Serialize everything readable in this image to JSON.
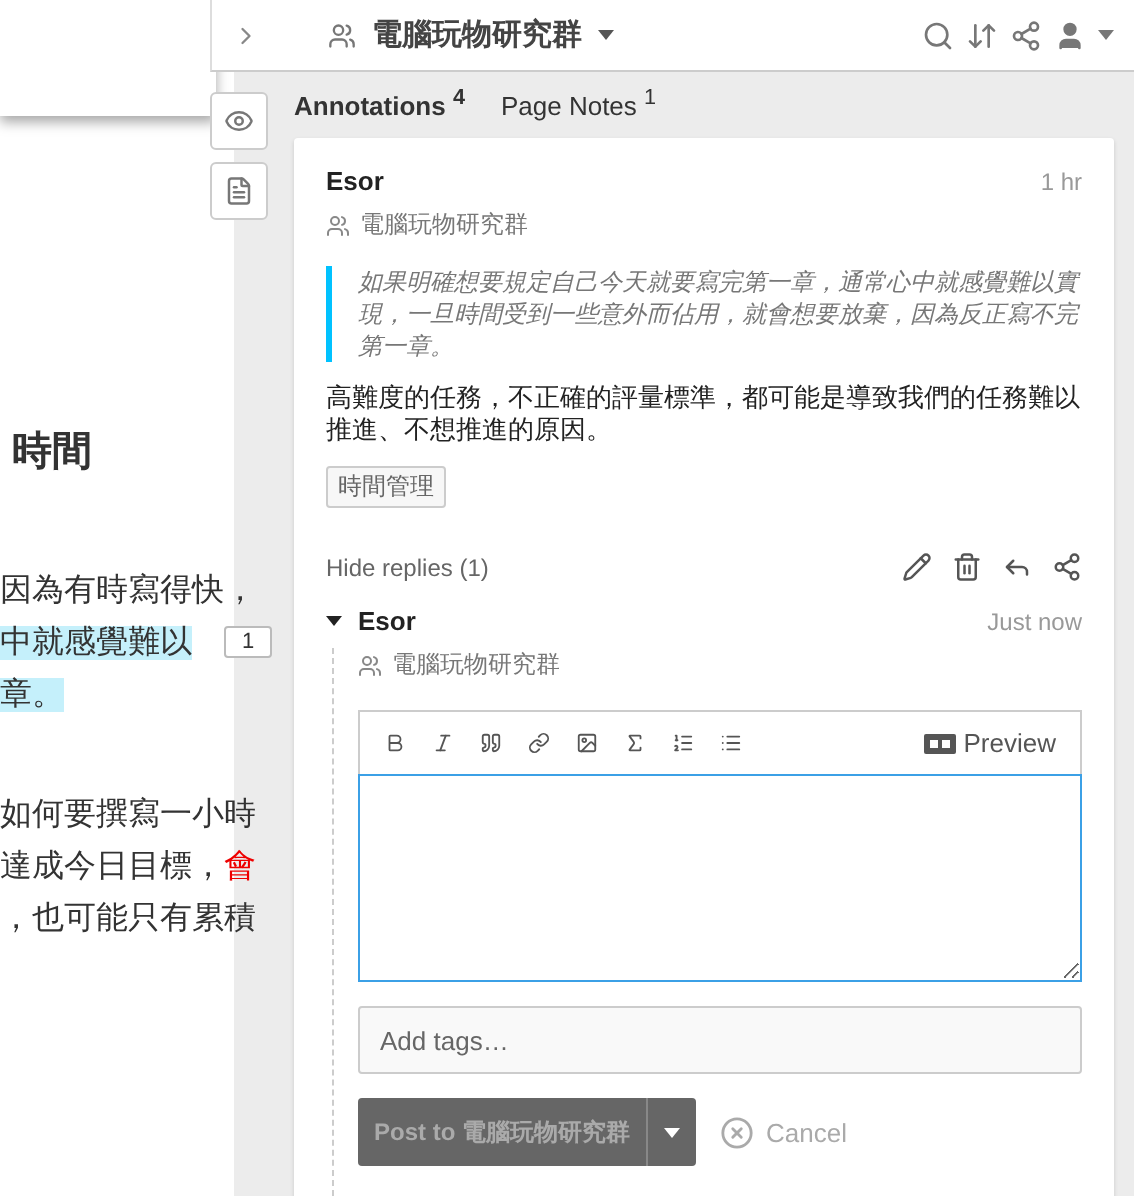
{
  "page": {
    "heading": "時間",
    "paragraphs": [
      {
        "lines": [
          {
            "segments": [
              {
                "text": "因為有時寫得快，",
                "highlighted": false,
                "emphasis": false
              }
            ]
          },
          {
            "segments": [
              {
                "text": "中就感覺難以",
                "highlighted": true,
                "emphasis": false
              }
            ],
            "badge": "1"
          },
          {
            "segments": [
              {
                "text": "章。",
                "highlighted": true,
                "emphasis": false
              }
            ]
          }
        ]
      },
      {
        "lines": [
          {
            "segments": [
              {
                "text": "如何要撰寫一小時",
                "highlighted": false,
                "emphasis": false
              }
            ]
          },
          {
            "segments": [
              {
                "text": "達成今日目標，",
                "highlighted": false,
                "emphasis": false
              },
              {
                "text": "會",
                "highlighted": false,
                "emphasis": true
              }
            ]
          },
          {
            "segments": [
              {
                "text": "，也可能只有累積",
                "highlighted": false,
                "emphasis": false
              }
            ]
          }
        ]
      }
    ]
  },
  "top_bar": {
    "group": "電腦玩物研究群"
  },
  "tabs": [
    {
      "label": "Annotations",
      "count": "4",
      "selected": true
    },
    {
      "label": "Page Notes",
      "count": "1",
      "selected": false
    }
  ],
  "annotation": {
    "author": "Esor",
    "time": "1 hr",
    "group": "電腦玩物研究群",
    "quote": "如果明確想要規定自己今天就要寫完第一章，通常心中就感覺難以實現，一旦時間受到一些意外而佔用，就會想要放棄，因為反正寫不完第一章。",
    "body": "高難度的任務，不正確的評量標準，都可能是導致我們的任務難以推進、不想推進的原因。",
    "tags": [
      "時間管理"
    ],
    "replies_toggle": "Hide replies (1)",
    "reply": {
      "author": "Esor",
      "time": "Just now",
      "group": "電腦玩物研究群",
      "expanded": true,
      "editor": {
        "preview": "Preview",
        "focused": true
      },
      "tags_placeholder": "Add tags…",
      "post_button": "Post to 電腦玩物研究群",
      "post_disabled": true,
      "cancel": "Cancel"
    }
  }
}
